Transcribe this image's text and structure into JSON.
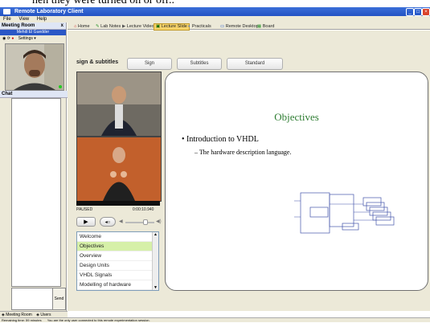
{
  "caption": "hen they were turned on or off..",
  "window": {
    "title": "Remote Laboratory Client"
  },
  "menu": [
    "File",
    "View",
    "Help"
  ],
  "left_panel": {
    "header": "Meeting Room",
    "close": "x",
    "username": "Mehdi El Guedder",
    "settings_label": "Settings",
    "chat_header": "Chat",
    "send_label": "Send",
    "bottom_tabs": [
      "Meeting Room",
      "Users"
    ]
  },
  "tabs": [
    {
      "label": "Home",
      "icon": "home-icon"
    },
    {
      "label": "Lab Notes",
      "icon": "notes-icon"
    },
    {
      "label": "Lecture Video",
      "icon": "video-icon"
    },
    {
      "label": "Lecture Slide",
      "icon": "slide-icon",
      "active": true
    },
    {
      "label": "Practicals",
      "icon": "practicals-icon"
    },
    {
      "label": "Remote Desktop",
      "icon": "desktop-icon"
    },
    {
      "label": "Board",
      "icon": "board-icon"
    }
  ],
  "modes": {
    "label": "sign & subtitles",
    "buttons": [
      "Sign",
      "Subtitles",
      "Standard"
    ]
  },
  "player": {
    "status": "PAUSED",
    "time": "0:00:10.940"
  },
  "slide": {
    "title": "Objectives",
    "bullet": "Introduction to VHDL",
    "sub_bullet": "The hardware description language."
  },
  "playlist": [
    "Welcome",
    "Objectives",
    "Overview",
    "Design Units",
    "VHDL Signals",
    "Modelling of hardware"
  ],
  "playlist_selected": 1,
  "status_bar": {
    "remaining": "Remaining time: 59 minutes",
    "message": "You are the only user connected to this remote experimentation session."
  },
  "colors": {
    "title": "#2a57c6",
    "slide_title": "#2e7d32",
    "selected": "#d6f0a8"
  }
}
